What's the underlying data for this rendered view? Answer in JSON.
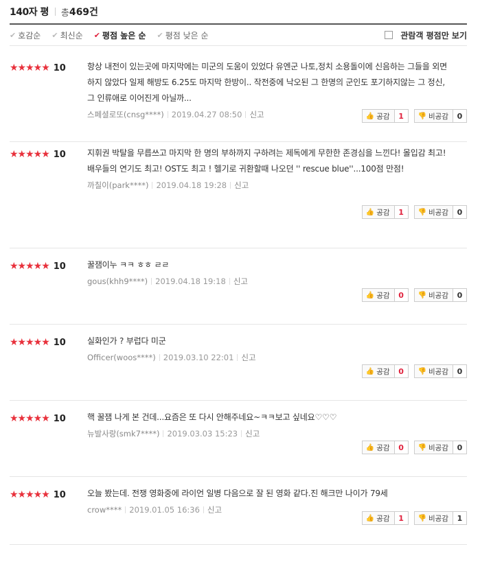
{
  "header": {
    "title": "140자 평",
    "total_label": "총",
    "total_count": "469건"
  },
  "sort": {
    "options": [
      {
        "label": "호감순"
      },
      {
        "label": "최신순"
      },
      {
        "label": "평점 높은 순"
      },
      {
        "label": "평점 낮은 순"
      }
    ],
    "selected": "평점 높은 순",
    "audience_label": "관람객 평점만 보기"
  },
  "vote_labels": {
    "like": "공감",
    "dislike": "비공감"
  },
  "reviews": [
    {
      "stars": 5,
      "score": "10",
      "text": "항상 내전이 있는곳에 마지막에는 미군의 도움이 있었다 유엔군 나토,정치 소용돌이에 신음하는 그들을 외면하지 않았다 일제 해방도 6.25도 마지막 한방이.. 작전중에 낙오된 그 한명의 군인도 포기하지않는 그 정신, 그 인류애로 이어진게 아닐까...",
      "user": "스페셜로또(cnsg****)",
      "date": "2019.04.27 08:50",
      "report": "신고",
      "like": "1",
      "dislike": "0"
    },
    {
      "stars": 5,
      "score": "10",
      "text": "지휘권 박탈을 무릅쓰고 마지막 한 명의 부하까지 구하려는 제독에게 무한한 존경심을 느낀다! 몰입감 최고! 배우들의 연기도 최고! OST도 최고 ! 헬기로 귀환할때 나오던 '' rescue blue''...100점 만점!",
      "user": "까칠이(park****)",
      "date": "2019.04.18 19:28",
      "report": "신고",
      "like": "1",
      "dislike": "0"
    },
    {
      "stars": 5,
      "score": "10",
      "text": "꿀잼이누 ㅋㅋ ㅎㅎ ㄹㄹ",
      "user": "gous(khh9****)",
      "date": "2019.04.18 19:18",
      "report": "신고",
      "like": "0",
      "dislike": "0"
    },
    {
      "stars": 5,
      "score": "10",
      "text": "실화인가 ? 부럽다 미군",
      "user": "Officer(woos****)",
      "date": "2019.03.10 22:01",
      "report": "신고",
      "like": "0",
      "dislike": "0"
    },
    {
      "stars": 5,
      "score": "10",
      "text": "핵 꿀잼 나게 본 건데...요즘은 또 다시 안해주네요~ㅋㅋ보고 싶네요♡♡♡",
      "user": "뉴발사랑(smk7****)",
      "date": "2019.03.03 15:23",
      "report": "신고",
      "like": "0",
      "dislike": "0"
    },
    {
      "stars": 5,
      "score": "10",
      "text": "오늘 봤는데. 전쟁 영화중에 라이언 일병 다음으로 잘 된 영화 같다.진 해크만 나이가 79세",
      "user": "crow****",
      "date": "2019.01.05 16:36",
      "report": "신고",
      "like": "1",
      "dislike": "1"
    }
  ]
}
